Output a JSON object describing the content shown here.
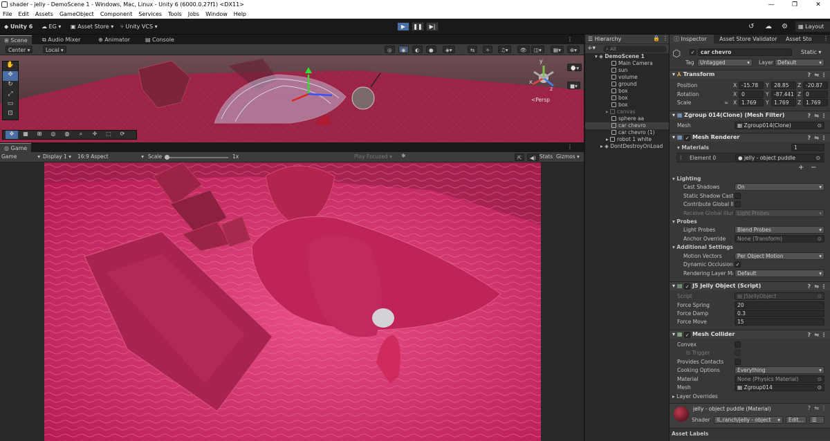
{
  "window": {
    "title": "shader - jelly - DemoScene 1 - Windows, Mac, Linux - Unity 6 (6000.0.27f1) <DX11>",
    "controls": [
      "—",
      "❐",
      "✕"
    ]
  },
  "menu": [
    "File",
    "Edit",
    "Assets",
    "GameObject",
    "Component",
    "Services",
    "Tools",
    "Jobs",
    "Window",
    "Help"
  ],
  "toolbar": {
    "unity": "Unity 6",
    "account": "EG",
    "asset_store": "Asset Store",
    "vcs": "Unity VCS",
    "layout": "Layout"
  },
  "scene_tabs": [
    "Scene",
    "Audio Mixer",
    "Animator",
    "Console"
  ],
  "scene_toolbar": {
    "pivot": "Center",
    "space": "Local",
    "persp": "<Persp",
    "gizmo_y": "y",
    "gizmo_x": "x",
    "gizmo_z": "z"
  },
  "game_tab": "Game",
  "game_toolbar": {
    "mode": "Game",
    "display": "Display 1",
    "aspect": "16:9 Aspect",
    "scale_label": "Scale",
    "scale_value": "1x",
    "play_focused": "Play Focused",
    "stats": "Stats",
    "gizmos": "Gizmos"
  },
  "hierarchy": {
    "title": "Hierarchy",
    "search": "All",
    "items": [
      {
        "label": "DemoScene 1",
        "depth": 0,
        "kind": "scene"
      },
      {
        "label": "Main Camera",
        "depth": 1
      },
      {
        "label": "sun",
        "depth": 1
      },
      {
        "label": "volume",
        "depth": 1
      },
      {
        "label": "ground",
        "depth": 1
      },
      {
        "label": "box",
        "depth": 1
      },
      {
        "label": "box",
        "depth": 1
      },
      {
        "label": "box",
        "depth": 1
      },
      {
        "label": "canvas",
        "depth": 1,
        "dim": true,
        "arrow": true
      },
      {
        "label": "sphere aa",
        "depth": 1
      },
      {
        "label": "car chevro",
        "depth": 1,
        "selected": true
      },
      {
        "label": "car chevro (1)",
        "depth": 1
      },
      {
        "label": "robot 1 white",
        "depth": 1,
        "arrow": true
      },
      {
        "label": "DontDestroyOnLoad",
        "depth": 0,
        "kind": "scene",
        "arrow": true
      }
    ]
  },
  "inspector": {
    "tabs": [
      "Inspector",
      "Asset Store Validator",
      "Asset Sto"
    ],
    "object_name": "car chevro",
    "static": "Static",
    "tag_label": "Tag",
    "tag": "Untagged",
    "layer_label": "Layer",
    "layer": "Default",
    "transform": {
      "title": "Transform",
      "position_label": "Position",
      "position": {
        "x": "-15.78",
        "y": "28.85",
        "z": "-20.87"
      },
      "rotation_label": "Rotation",
      "rotation": {
        "x": "0",
        "y": "-87.441",
        "z": "0"
      },
      "scale_label": "Scale",
      "scale": {
        "x": "1.769",
        "y": "1.769",
        "z": "1.769"
      }
    },
    "mesh_filter": {
      "title": "Zgroup 014(Clone) (Mesh Filter)",
      "mesh_label": "Mesh",
      "mesh": "Zgroup014(Clone)"
    },
    "mesh_renderer": {
      "title": "Mesh Renderer",
      "materials_label": "Materials",
      "materials_count": "1",
      "element_label": "Element 0",
      "element_value": "jelly - object puddle",
      "lighting": "Lighting",
      "cast_shadows_label": "Cast Shadows",
      "cast_shadows": "On",
      "static_shadow_label": "Static Shadow Caste",
      "contribute_gi_label": "Contribute Global Illu",
      "receive_gi_label": "Receive Global Illum",
      "receive_gi": "Light Probes",
      "probes": "Probes",
      "light_probes_label": "Light Probes",
      "light_probes": "Blend Probes",
      "anchor_override_label": "Anchor Override",
      "anchor_override": "None (Transform)",
      "additional": "Additional Settings",
      "motion_vectors_label": "Motion Vectors",
      "motion_vectors": "Per Object Motion",
      "dynamic_occlusion_label": "Dynamic Occlusion",
      "rendering_layer_label": "Rendering Layer Ma",
      "rendering_layer": "Default"
    },
    "jelly": {
      "title": "J5 Jelly Object (Script)",
      "script_label": "Script",
      "script": "J5JellyObject",
      "force_spring_label": "Force Spring",
      "force_spring": "20",
      "force_damp_label": "Force Damp",
      "force_damp": "0.3",
      "force_move_label": "Force Move",
      "force_move": "15"
    },
    "mesh_collider": {
      "title": "Mesh Collider",
      "convex_label": "Convex",
      "is_trigger_label": "Is Trigger",
      "provides_contacts_label": "Provides Contacts",
      "cooking_label": "Cooking Options",
      "cooking": "Everything",
      "material_label": "Material",
      "material": "None (Physics Material)",
      "mesh_label": "Mesh",
      "mesh": "Zgroup014",
      "layer_overrides": "Layer Overrides"
    },
    "material_footer": {
      "name": "jelly - object puddle (Material)",
      "shader_label": "Shader",
      "shader": "IL.ranch/jelly - object",
      "edit": "Edit...",
      "list": "☰"
    },
    "asset_labels": "Asset Labels"
  },
  "colors": {
    "accent": "#2c5d87",
    "jelly": "#d02a64",
    "selection": "#3e3e3e"
  }
}
